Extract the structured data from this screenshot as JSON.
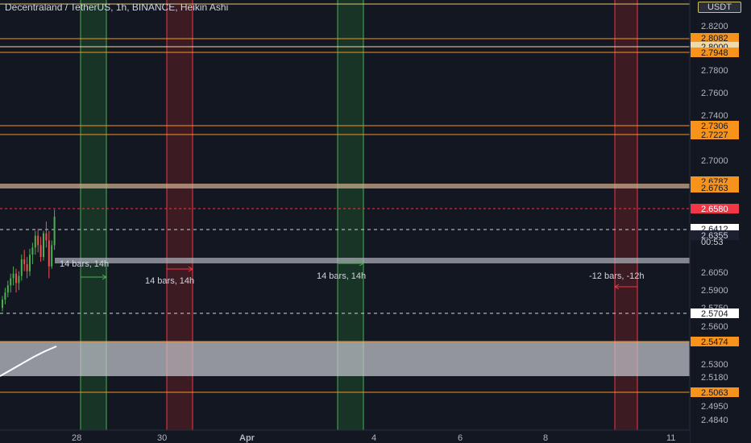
{
  "header": {
    "title": "Decentraland / TetherUS, 1h, BINANCE, Heikin Ashi",
    "currency": "USDT"
  },
  "price_axis": {
    "ticks": [
      "2.8200",
      "2.7800",
      "2.7600",
      "2.7400",
      "2.7000",
      "2.6050",
      "2.5900",
      "2.5750",
      "2.5600",
      "2.5300",
      "2.5180",
      "2.4950",
      "2.4840"
    ],
    "labels": [
      {
        "value": "2.8082",
        "kind": "orange"
      },
      {
        "value": "2.8000",
        "kind": "light"
      },
      {
        "value": "2.7948",
        "kind": "orange"
      },
      {
        "value": "2.7306",
        "kind": "orange"
      },
      {
        "value": "2.7227",
        "kind": "orange"
      },
      {
        "value": "2.6787",
        "kind": "orange"
      },
      {
        "value": "2.6763",
        "kind": "orange"
      },
      {
        "value": "2.6580",
        "kind": "red"
      },
      {
        "value": "2.6412",
        "kind": "white"
      },
      {
        "value": "2.6355",
        "kind": "dark"
      },
      {
        "value": "2.5704",
        "kind": "white"
      },
      {
        "value": "2.5474",
        "kind": "orange"
      },
      {
        "value": "2.5063",
        "kind": "orange"
      }
    ],
    "countdown": "00:53"
  },
  "time_axis": {
    "labels": [
      "28",
      "30",
      "Apr",
      "4",
      "6",
      "8",
      "11"
    ]
  },
  "annotations": [
    "14 bars, 14h",
    "14 bars, 14h",
    "14 bars, 14h",
    "-12 bars, -12h"
  ],
  "colors": {
    "background": "#131722",
    "orange": "#f7931a",
    "red_zone": "#f23645",
    "green_zone": "#2e7d32",
    "up_candle": "#4caf50",
    "down_candle": "#ef5350"
  },
  "chart_data": {
    "type": "candlestick",
    "style": "Heikin Ashi",
    "interval": "1h",
    "current_price": 2.6355,
    "high_marker": 2.658,
    "ohlc": [
      [
        2.575,
        2.585,
        2.572,
        2.582
      ],
      [
        2.582,
        2.592,
        2.578,
        2.588
      ],
      [
        2.588,
        2.598,
        2.584,
        2.594
      ],
      [
        2.594,
        2.604,
        2.588,
        2.6
      ],
      [
        2.6,
        2.61,
        2.594,
        2.604
      ],
      [
        2.604,
        2.608,
        2.588,
        2.596
      ],
      [
        2.596,
        2.606,
        2.59,
        2.602
      ],
      [
        2.602,
        2.62,
        2.598,
        2.616
      ],
      [
        2.616,
        2.624,
        2.606,
        2.612
      ],
      [
        2.612,
        2.618,
        2.6,
        2.606
      ],
      [
        2.606,
        2.625,
        2.602,
        2.62
      ],
      [
        2.62,
        2.63,
        2.612,
        2.626
      ],
      [
        2.626,
        2.64,
        2.62,
        2.636
      ],
      [
        2.636,
        2.642,
        2.622,
        2.628
      ],
      [
        2.628,
        2.635,
        2.614,
        2.618
      ],
      [
        2.618,
        2.64,
        2.615,
        2.638
      ],
      [
        2.638,
        2.648,
        2.626,
        2.632
      ],
      [
        2.632,
        2.64,
        2.6,
        2.61
      ],
      [
        2.61,
        2.632,
        2.608,
        2.628
      ],
      [
        2.628,
        2.658,
        2.624,
        2.652
      ]
    ]
  }
}
